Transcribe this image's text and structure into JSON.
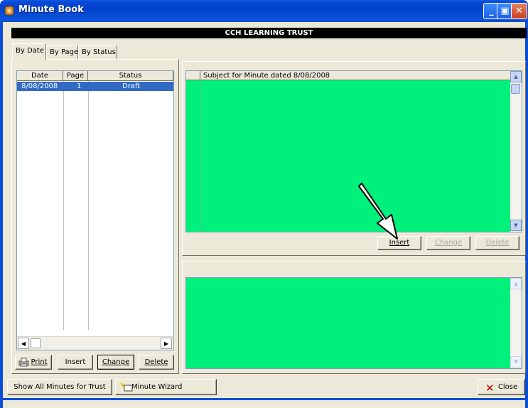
{
  "window": {
    "title": "Minute Book",
    "min_glyph": "_",
    "max_glyph": "▣",
    "close_glyph": "✕"
  },
  "banner": "CCH LEARNING TRUST",
  "tabs": [
    "By Date",
    "By Page",
    "By Status"
  ],
  "grid": {
    "columns": [
      "Date",
      "Page",
      "Status"
    ],
    "rows": [
      {
        "date": "8/08/2008",
        "page": "1",
        "status": "Draft"
      }
    ]
  },
  "left_buttons": {
    "print": "Print",
    "insert": "Insert",
    "change": "Change",
    "delete": "Delete"
  },
  "subject": {
    "header": "Subject for Minute dated  8/08/2008"
  },
  "subject_buttons": {
    "insert": "Insert",
    "change": "Change",
    "delete": "Delete"
  },
  "footer": {
    "show_all": "Show All Minutes for Trust",
    "wizard": "Minute Wizard",
    "close": "Close"
  },
  "colors": {
    "green": "#00f07c",
    "title_blue": "#0042cc",
    "selection": "#316ac5"
  }
}
